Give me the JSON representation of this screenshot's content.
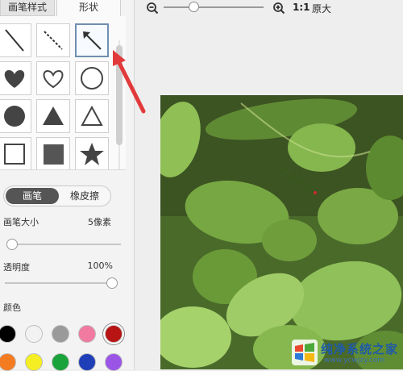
{
  "tabs": {
    "brush_style": "画笔样式",
    "shape": "形状",
    "active": "shape"
  },
  "shapes": [
    {
      "name": "line",
      "icon": "line-icon"
    },
    {
      "name": "dashed-line",
      "icon": "dashed-line-icon"
    },
    {
      "name": "arrow",
      "icon": "arrow-icon",
      "selected": true
    },
    {
      "name": "heart-filled",
      "icon": "heart-filled-icon"
    },
    {
      "name": "heart-outline",
      "icon": "heart-outline-icon"
    },
    {
      "name": "circle-outline",
      "icon": "circle-outline-icon"
    },
    {
      "name": "circle-filled",
      "icon": "circle-filled-icon"
    },
    {
      "name": "triangle-filled",
      "icon": "triangle-filled-icon"
    },
    {
      "name": "triangle-outline",
      "icon": "triangle-outline-icon"
    },
    {
      "name": "square-outline",
      "icon": "square-outline-icon"
    },
    {
      "name": "square-filled",
      "icon": "square-filled-icon"
    },
    {
      "name": "star-filled",
      "icon": "star-filled-icon"
    }
  ],
  "mode": {
    "brush_label": "画笔",
    "eraser_label": "橡皮擦",
    "active": "brush"
  },
  "brush_size": {
    "label": "画笔大小",
    "value_text": "5像素",
    "level": 0.05
  },
  "opacity": {
    "label": "透明度",
    "value_text": "100%",
    "level": 1.0
  },
  "colors": {
    "label": "颜色",
    "swatches": [
      "#000000",
      "#f2f2f2",
      "#9a9a9a",
      "#f07aa0",
      "#b81414",
      "#f47b20",
      "#f5ee22",
      "#1aa33a",
      "#1f3fb8",
      "#9a55e6"
    ],
    "selected_index": 4
  },
  "zoom": {
    "ratio_label": "1:1",
    "actual_label": "原大",
    "level": 0.3,
    "zoom_out_icon": "zoom-out-icon",
    "zoom_in_icon": "zoom-in-icon"
  },
  "canvas": {
    "content": "photo of green mint leaves"
  },
  "watermark": {
    "title": "纯净系统之家",
    "url": "www.ycwjzy.com"
  },
  "accent_colors": {
    "arrow_annotation": "#e23a3a",
    "selected_border": "#6f8fb0",
    "brush_active": "#555555"
  }
}
